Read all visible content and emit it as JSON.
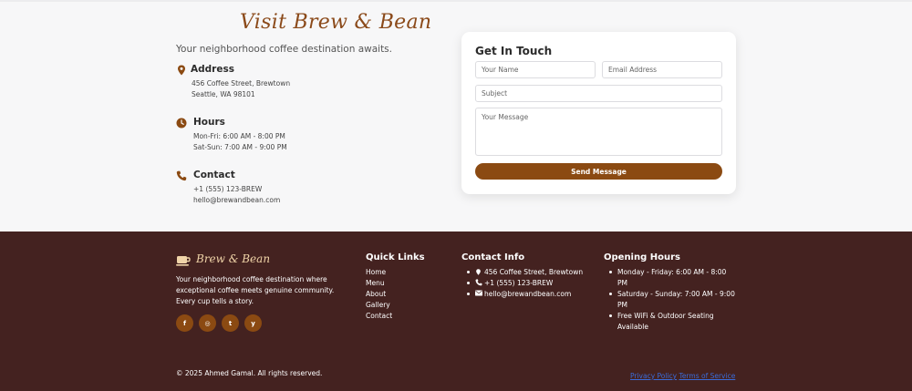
{
  "contact": {
    "title": "Visit Brew & Bean",
    "tagline": "Your neighborhood coffee destination awaits.",
    "address": {
      "heading": "Address",
      "lines": [
        "456 Coffee Street, Brewtown",
        "Seattle, WA 98101"
      ],
      "icon": "map-pin-icon"
    },
    "hours": {
      "heading": "Hours",
      "lines": [
        "Mon-Fri: 6:00 AM - 8:00 PM",
        "Sat-Sun: 7:00 AM - 9:00 PM"
      ],
      "icon": "clock-icon"
    },
    "phone_block": {
      "heading": "Contact",
      "lines": [
        "+1 (555) 123-BREW",
        "hello@brewandbean.com"
      ],
      "icon": "phone-icon"
    }
  },
  "form": {
    "title": "Get In Touch",
    "name_placeholder": "Your Name",
    "email_placeholder": "Email Address",
    "subject_placeholder": "Subject",
    "message_placeholder": "Your Message",
    "submit_label": "Send Message"
  },
  "footer": {
    "brand_name": "Brew & Bean",
    "brand_icon": "coffee-cup-icon",
    "description": "Your neighborhood coffee destination where exceptional coffee meets genuine community. Every cup tells a story.",
    "socials": [
      {
        "name": "facebook-icon",
        "glyph": "f"
      },
      {
        "name": "instagram-icon",
        "glyph": "◎"
      },
      {
        "name": "twitter-icon",
        "glyph": "t"
      },
      {
        "name": "yelp-icon",
        "glyph": "y"
      }
    ],
    "quick_links_title": "Quick Links",
    "quick_links": [
      "Home",
      "Menu",
      "About",
      "Gallery",
      "Contact"
    ],
    "contact_info_title": "Contact Info",
    "contact_info": [
      {
        "icon": "map-pin-icon",
        "glyph": "⬤",
        "text": "456 Coffee Street, Brewtown"
      },
      {
        "icon": "phone-icon",
        "glyph": "✆",
        "text": "+1 (555) 123-BREW"
      },
      {
        "icon": "envelope-icon",
        "glyph": "✉",
        "text": "hello@brewandbean.com"
      }
    ],
    "opening_hours_title": "Opening Hours",
    "opening_hours": [
      "Monday - Friday: 6:00 AM - 8:00 PM",
      "Saturday - Sunday: 7:00 AM - 9:00 PM",
      "Free WiFi & Outdoor Seating Available"
    ],
    "copyright": "© 2025 Ahmed Gamal. All rights reserved.",
    "privacy_label": "Privacy Policy",
    "terms_label": "Terms of Service"
  },
  "colors": {
    "accent": "#8b4a12",
    "footer_bg": "#442220",
    "title": "#8b4a1a",
    "link": "#3b6bd8"
  }
}
